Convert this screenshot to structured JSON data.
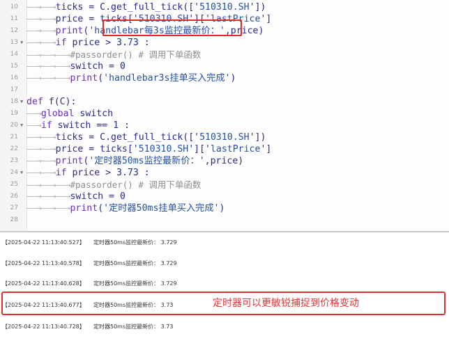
{
  "editor": {
    "lines": [
      {
        "num": "10",
        "fold": "",
        "indent": 2,
        "tokens": [
          [
            "plain",
            "ticks = C.get_full_tick(['"
          ],
          [
            "str",
            "510310.SH"
          ],
          [
            "plain",
            "'])"
          ]
        ]
      },
      {
        "num": "11",
        "fold": "",
        "indent": 2,
        "tokens": [
          [
            "plain",
            "price = ticks['"
          ],
          [
            "str",
            "510310.SH"
          ],
          [
            "plain",
            "']['"
          ],
          [
            "str",
            "lastPrice"
          ],
          [
            "plain",
            "']"
          ]
        ]
      },
      {
        "num": "12",
        "fold": "",
        "indent": 2,
        "tokens": [
          [
            "kw",
            "print"
          ],
          [
            "plain",
            "("
          ],
          [
            "str",
            "'handlebar每3s监控最新价：'"
          ],
          [
            "plain",
            ",price)"
          ]
        ]
      },
      {
        "num": "13",
        "fold": "▼",
        "indent": 2,
        "tokens": [
          [
            "kw",
            "if"
          ],
          [
            "plain",
            " price > "
          ],
          [
            "num",
            "3.73"
          ],
          [
            "plain",
            " :"
          ]
        ]
      },
      {
        "num": "14",
        "fold": "",
        "indent": 3,
        "tokens": [
          [
            "cmt",
            "#passorder() # 调用下单函数"
          ]
        ]
      },
      {
        "num": "15",
        "fold": "",
        "indent": 3,
        "tokens": [
          [
            "plain",
            "switch = "
          ],
          [
            "num",
            "0"
          ]
        ]
      },
      {
        "num": "16",
        "fold": "",
        "indent": 3,
        "tokens": [
          [
            "kw",
            "print"
          ],
          [
            "plain",
            "("
          ],
          [
            "str",
            "'handlebar3s挂单买入完成'"
          ],
          [
            "plain",
            ")"
          ]
        ]
      },
      {
        "num": "17",
        "fold": "",
        "indent": 0,
        "tokens": []
      },
      {
        "num": "18",
        "fold": "▼",
        "indent": 0,
        "tokens": [
          [
            "kw",
            "def"
          ],
          [
            "plain",
            " f(C):"
          ]
        ]
      },
      {
        "num": "19",
        "fold": "",
        "indent": 1,
        "tokens": [
          [
            "kw",
            "global"
          ],
          [
            "plain",
            " switch"
          ]
        ]
      },
      {
        "num": "20",
        "fold": "▼",
        "indent": 1,
        "tokens": [
          [
            "kw",
            "if"
          ],
          [
            "plain",
            " switch == "
          ],
          [
            "num",
            "1"
          ],
          [
            "plain",
            " :"
          ]
        ]
      },
      {
        "num": "21",
        "fold": "",
        "indent": 2,
        "tokens": [
          [
            "plain",
            "ticks = C.get_full_tick(['"
          ],
          [
            "str",
            "510310.SH"
          ],
          [
            "plain",
            "'])"
          ]
        ]
      },
      {
        "num": "22",
        "fold": "",
        "indent": 2,
        "tokens": [
          [
            "plain",
            "price = ticks['"
          ],
          [
            "str",
            "510310.SH"
          ],
          [
            "plain",
            "']['"
          ],
          [
            "str",
            "lastPrice"
          ],
          [
            "plain",
            "']"
          ]
        ]
      },
      {
        "num": "23",
        "fold": "",
        "indent": 2,
        "tokens": [
          [
            "kw",
            "print"
          ],
          [
            "plain",
            "("
          ],
          [
            "str",
            "'定时器50ms监控最新价：'"
          ],
          [
            "plain",
            ",price)"
          ]
        ]
      },
      {
        "num": "24",
        "fold": "▼",
        "indent": 2,
        "tokens": [
          [
            "kw",
            "if"
          ],
          [
            "plain",
            " price > "
          ],
          [
            "num",
            "3.73"
          ],
          [
            "plain",
            " :"
          ]
        ]
      },
      {
        "num": "25",
        "fold": "",
        "indent": 3,
        "tokens": [
          [
            "cmt",
            "#passorder() # 调用下单函数"
          ]
        ]
      },
      {
        "num": "26",
        "fold": "",
        "indent": 3,
        "tokens": [
          [
            "plain",
            "switch = "
          ],
          [
            "num",
            "0"
          ]
        ]
      },
      {
        "num": "27",
        "fold": "",
        "indent": 3,
        "tokens": [
          [
            "kw",
            "print"
          ],
          [
            "plain",
            "("
          ],
          [
            "str",
            "'定时器50ms挂单买入完成'"
          ],
          [
            "plain",
            ")"
          ]
        ]
      },
      {
        "num": "28",
        "fold": "",
        "indent": 0,
        "tokens": []
      }
    ],
    "indent_arrow": "——→",
    "highlight_color": "#e02a2a"
  },
  "console": {
    "logs": [
      {
        "timestamp": "【2025-04-22 11:13:40.527】",
        "message": "定时器50ms监控最新价： 3.729"
      },
      {
        "timestamp": "【2025-04-22 11:13:40.578】",
        "message": "定时器50ms监控最新价： 3.729"
      },
      {
        "timestamp": "【2025-04-22 11:13:40.628】",
        "message": "定时器50ms监控最新价： 3.729"
      },
      {
        "timestamp": "【2025-04-22 11:13:40.677】",
        "message": "定时器50ms监控最新价： 3.73"
      },
      {
        "timestamp": "【2025-04-22 11:13:40.728】",
        "message": "定时器50ms监控最新价： 3.73"
      }
    ],
    "annotation": "定时器可以更敏锐捕捉到价格变动",
    "annotation_color": "#e33333"
  }
}
